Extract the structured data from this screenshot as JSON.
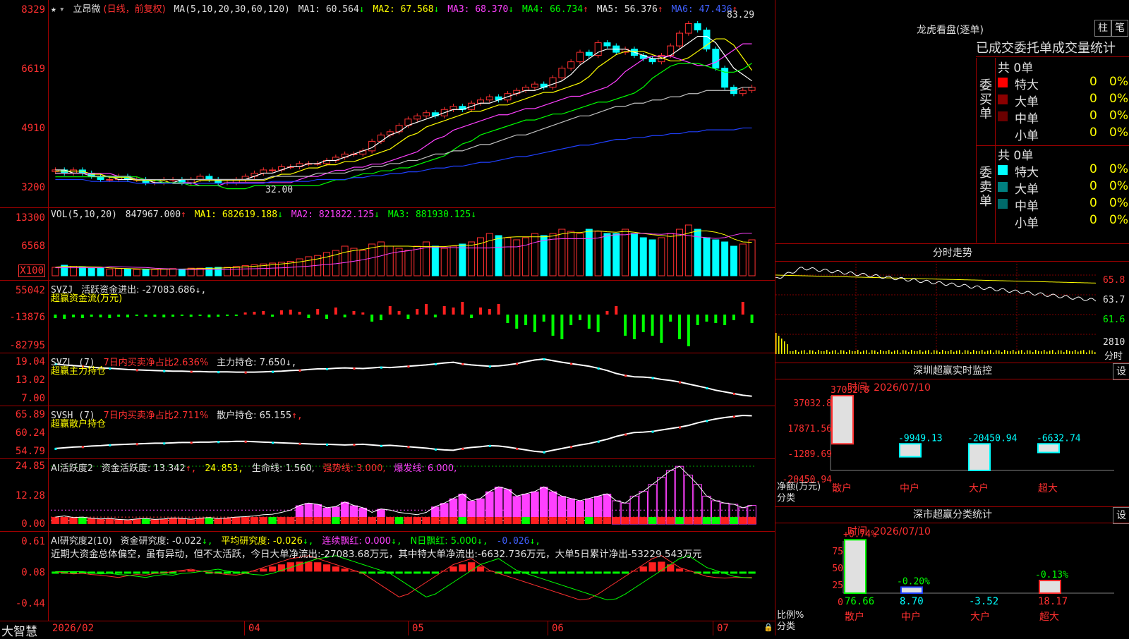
{
  "stock": {
    "name": "立昂微",
    "period": "(日线，前复权)"
  },
  "main": {
    "ma_label": "MA(5,10,20,30,60,120)",
    "ma1": "MA1: 60.564",
    "ma1_arrow": "↓",
    "ma2": "MA2: 67.568",
    "ma2_arrow": "↓",
    "ma3": "MA3: 68.370",
    "ma3_arrow": "↓",
    "ma4": "MA4: 66.734",
    "ma4_arrow": "↑",
    "ma5": "MA5: 56.376",
    "ma5_arrow": "↑",
    "ma6": "MA6: 47.436",
    "ma6_arrow": "↑",
    "y_ticks": [
      "8329",
      "6619",
      "4910",
      "3200"
    ],
    "high_label": "83.29",
    "low_label": "32.00"
  },
  "vol": {
    "label": "VOL(5,10,20)",
    "value": "847967.000",
    "value_arrow": "↑",
    "ma1": "MA1: 682619.188",
    "ma1_arrow": "↓",
    "ma2": "MA2: 821822.125",
    "ma2_arrow": "↓",
    "ma3": "MA3: 881930.125",
    "ma3_arrow": "↓",
    "y_ticks": [
      "13300",
      "6568"
    ],
    "unit": "X100"
  },
  "svzj": {
    "label": "SVZJ",
    "text": "活跃资金进出: -27083.686",
    "arrow": "↓,",
    "sub": "超赢资金流(万元)",
    "y_ticks": [
      "55042",
      "-13876",
      "-82795"
    ]
  },
  "svzl": {
    "label": "SVZL (7)",
    "ratio": "7日内买卖净占比2.636%",
    "hold": "主力持仓: 7.650",
    "arrow": "↓,",
    "sub": "超赢主力持仓",
    "y_ticks": [
      "19.04",
      "13.02",
      "7.00"
    ]
  },
  "svsh": {
    "label": "SVSH (7)",
    "ratio": "7日内买卖净占比2.711%",
    "hold": "散户持仓: 65.155",
    "arrow": "↑,",
    "sub": "超赢散户持仓",
    "y_ticks": [
      "65.89",
      "60.24",
      "54.79"
    ]
  },
  "ai1": {
    "label": "AI活跃度2",
    "t1": "资金活跃度: 13.342",
    "a1": "↑,",
    "t2": "24.853,",
    "t3": "生命线: 1.560,",
    "t4": "强势线: 3.000,",
    "t5": "爆发线: 6.000,",
    "y_ticks": [
      "24.85",
      "12.28",
      "0.00"
    ]
  },
  "ai2": {
    "label": "AI研究度2(10)",
    "t1": "资金研究度: -0.022",
    "a1": "↓,",
    "t2": "平均研究度: -0.026",
    "a2": "↓,",
    "t3": "连续飘红: 0.000",
    "a3": "↓,",
    "t4": "N日飘红: 5.000",
    "a4": "↓,",
    "t5": "-0.026",
    "a5": "↓,",
    "comment": "近期大资金总体偏空，虽有异动，但不太活跃，今日大单净流出:-27083.68万元，其中特大单净流出:-6632.736万元，大单5日累计净出-53229.543万元",
    "y_ticks": [
      "0.61",
      "0.08",
      "-0.44"
    ]
  },
  "x_axis": {
    "labels": [
      "2026/02",
      "04",
      "05",
      "06",
      "07"
    ],
    "brand": "大智慧"
  },
  "lhb": {
    "title": "龙虎看盘(逐单)",
    "btn1": "柱",
    "btn2": "笔",
    "header": "已成交委托单成交量统计",
    "buy_label": "委买单",
    "sell_label": "委卖单",
    "buy_total": "共 0单",
    "sell_total": "共 0单",
    "rows": [
      {
        "name": "特大",
        "v": "0",
        "p": "0%",
        "color": "#ff0000"
      },
      {
        "name": "大单",
        "v": "0",
        "p": "0%",
        "color": "#8b0000"
      },
      {
        "name": "中单",
        "v": "0",
        "p": "0%",
        "color": "#6b0000"
      },
      {
        "name": "小单",
        "v": "0",
        "p": "0%",
        "color": ""
      }
    ],
    "sell_rows": [
      {
        "name": "特大",
        "v": "0",
        "p": "0%",
        "color": "#00ffff"
      },
      {
        "name": "大单",
        "v": "0",
        "p": "0%",
        "color": "#008080"
      },
      {
        "name": "中单",
        "v": "0",
        "p": "0%",
        "color": "#006b6b"
      },
      {
        "name": "小单",
        "v": "0",
        "p": "0%",
        "color": ""
      }
    ]
  },
  "fenshi": {
    "title": "分时走势",
    "p1": "65.8",
    "p2": "63.7",
    "p3": "61.6",
    "vol": "2810",
    "vlab": "分时"
  },
  "monitor": {
    "title": "深圳超赢实时监控",
    "btn": "设",
    "time": "时间: 2026/07/10",
    "ylab": [
      "37032.8",
      "17871.56",
      "-1289.69",
      "-20450.94"
    ],
    "unit1": "净额(万元)",
    "unit2": "分类",
    "bars": [
      {
        "cat": "散户",
        "value": 37032.8,
        "label": "37032.8"
      },
      {
        "cat": "中户",
        "value": -9949.13,
        "label": "-9949.13"
      },
      {
        "cat": "大户",
        "value": -20450.94,
        "label": "-20450.94"
      },
      {
        "cat": "超大",
        "value": -6632.74,
        "label": "-6632.74"
      }
    ]
  },
  "classify": {
    "title": "深市超赢分类统计",
    "btn": "设",
    "time": "时间: 2026/07/10",
    "ylab": [
      "75",
      "50",
      "25",
      "0"
    ],
    "unit1": "比例%",
    "unit2": "分类",
    "bars": [
      {
        "cat": "散户",
        "value": 76.66,
        "chg": "+0.74%"
      },
      {
        "cat": "中户",
        "value": 8.7,
        "chg": "-0.20%"
      },
      {
        "cat": "大户",
        "value": -3.52,
        "chg": ""
      },
      {
        "cat": "超大",
        "value": 18.17,
        "chg": "-0.13%"
      }
    ],
    "vals": [
      "76.66",
      "8.70",
      "-3.52",
      "18.17"
    ]
  },
  "chart_data": {
    "type": "candlestick",
    "ylim": [
      3200,
      8329
    ],
    "closes": [
      36,
      35,
      36,
      35,
      34,
      33,
      33,
      34,
      33,
      33,
      32,
      32,
      33,
      33,
      32,
      33,
      34,
      33,
      32,
      32,
      33,
      34,
      35,
      36,
      36,
      37,
      37,
      38,
      38,
      38,
      39,
      40,
      41,
      41,
      42,
      45,
      47,
      48,
      50,
      52,
      53,
      54,
      53,
      55,
      56,
      55,
      57,
      58,
      59,
      58,
      60,
      61,
      62,
      63,
      62,
      65,
      68,
      70,
      73,
      72,
      76,
      75,
      73,
      74,
      72,
      71,
      70,
      72,
      75,
      79,
      82,
      80,
      74,
      68,
      62,
      60,
      61,
      62
    ],
    "ma5": [
      36,
      36,
      35,
      35,
      34,
      34,
      34,
      33,
      33,
      33,
      33,
      32,
      32,
      32,
      33,
      33,
      33,
      33,
      33,
      33,
      33,
      33,
      34,
      35,
      35,
      36,
      37,
      37,
      38,
      38,
      39,
      39,
      40,
      41,
      42,
      43,
      45,
      47,
      48,
      50,
      51,
      52,
      53,
      54,
      55,
      55,
      56,
      57,
      57,
      58,
      59,
      60,
      61,
      61,
      62,
      63,
      64,
      66,
      69,
      71,
      73,
      74,
      74,
      74,
      73,
      72,
      71,
      71,
      72,
      74,
      76,
      78,
      78,
      76,
      72,
      68,
      66,
      64
    ],
    "ma60": [
      35,
      35,
      35,
      35,
      34,
      34,
      34,
      34,
      34,
      33,
      33,
      33,
      33,
      33,
      33,
      33,
      33,
      33,
      33,
      33,
      33,
      33,
      33,
      33,
      34,
      34,
      34,
      34,
      34,
      35,
      35,
      35,
      35,
      36,
      36,
      37,
      37,
      38,
      38,
      39,
      39,
      40,
      41,
      41,
      42,
      42,
      43,
      44,
      44,
      45,
      46,
      47,
      47,
      48,
      49,
      50,
      51,
      52,
      53,
      53,
      54,
      55,
      56,
      56,
      57,
      57,
      58,
      58,
      59,
      59,
      60,
      60,
      61,
      61,
      61,
      61,
      62,
      62
    ],
    "vol": [
      2,
      2.5,
      2.2,
      2,
      1.8,
      1.8,
      1.6,
      1.7,
      1.6,
      1.5,
      1.5,
      1.5,
      1.6,
      1.7,
      1.6,
      1.8,
      1.8,
      1.9,
      2,
      2,
      2.2,
      2.4,
      2.6,
      2.8,
      3,
      3.2,
      3.4,
      4,
      4.5,
      4.8,
      5.5,
      6,
      7,
      6.5,
      6,
      7.5,
      8,
      7,
      6.5,
      6,
      7,
      8,
      7,
      6.5,
      7,
      7.5,
      8,
      9,
      10,
      9.5,
      9,
      8.5,
      9,
      10,
      9.5,
      10,
      11,
      10.5,
      10,
      11,
      10.5,
      10,
      10,
      11,
      10,
      9,
      8.5,
      9,
      10,
      11,
      12,
      11,
      9,
      8.5,
      8,
      7,
      7.5,
      8.5
    ],
    "svzj": [
      -5,
      -6,
      -4,
      -5,
      -3,
      -4,
      -5,
      -3,
      -4,
      -2,
      -3,
      -3,
      -4,
      -3,
      -2,
      -3,
      -2,
      -4,
      -3,
      -2,
      -2,
      3,
      4,
      5,
      -3,
      6,
      7,
      4,
      -5,
      8,
      -6,
      10,
      -4,
      5,
      3,
      -10,
      -8,
      12,
      5,
      -6,
      8,
      15,
      -4,
      12,
      10,
      18,
      -5,
      10,
      8,
      15,
      -12,
      -20,
      -15,
      -25,
      -10,
      -30,
      -35,
      -15,
      -8,
      -20,
      -25,
      5,
      12,
      -30,
      -35,
      -25,
      -30,
      -40,
      -10,
      -35,
      -45,
      -15,
      -10,
      -12,
      -15,
      -8,
      18,
      -12
    ],
    "svzl": [
      17.5,
      17.2,
      17,
      16.8,
      16.5,
      16.3,
      16.2,
      16,
      15.8,
      15.7,
      15.6,
      15.5,
      15.4,
      15.3,
      15.3,
      15.2,
      15.2,
      15.1,
      15.1,
      15.1,
      15,
      15,
      15,
      15.1,
      15.2,
      15.3,
      15.5,
      15.6,
      15.8,
      16,
      16,
      16.2,
      16.3,
      16.2,
      16.1,
      16.3,
      16.5,
      16.4,
      16.6,
      16.8,
      17,
      17.2,
      17.5,
      17.8,
      18,
      17.5,
      17.2,
      17,
      16.8,
      16.9,
      17.2,
      17.6,
      18.2,
      18.7,
      19,
      18.5,
      18,
      17.6,
      17.2,
      16.8,
      16.2,
      15.5,
      14.6,
      14,
      13.6,
      13.5,
      13.3,
      12.8,
      12.5,
      12,
      11.4,
      10.8,
      10.2,
      9.5,
      9,
      8.5,
      8,
      7.7
    ],
    "svsh": [
      56,
      56.2,
      56.4,
      56.5,
      56.7,
      56.8,
      57,
      57.1,
      57.2,
      57.3,
      57.4,
      57.5,
      57.5,
      57.6,
      57.7,
      57.7,
      57.8,
      57.8,
      57.9,
      57.9,
      58,
      58,
      57.9,
      57.8,
      57.7,
      57.6,
      57.5,
      57.4,
      57.3,
      57.2,
      57.2,
      57.1,
      57,
      57.1,
      57.2,
      57,
      56.8,
      56.9,
      56.7,
      56.5,
      56.3,
      56.1,
      55.8,
      55.6,
      55.5,
      56,
      56.3,
      56.5,
      56.8,
      56.7,
      56.4,
      56,
      55.6,
      55.2,
      55,
      55.5,
      56,
      56.5,
      57,
      57.4,
      58,
      58.6,
      59.4,
      60,
      60.5,
      60.6,
      60.8,
      61.2,
      61.6,
      62,
      62.5,
      63.2,
      63.8,
      64.3,
      64.7,
      65,
      65.3,
      65.2
    ],
    "ai1": [
      3,
      3.5,
      2.8,
      3,
      2.5,
      2.2,
      2.4,
      2,
      1.8,
      2.2,
      2.4,
      2,
      2.2,
      2.6,
      2.4,
      2.1,
      2.5,
      2.8,
      2.3,
      2.6,
      3,
      3.2,
      3.5,
      4,
      4.2,
      5,
      6,
      8,
      9,
      8.5,
      7,
      7.5,
      9.5,
      8,
      7,
      5,
      6.5,
      6,
      5,
      4.5,
      4,
      5,
      7.5,
      9,
      11,
      13,
      10,
      11,
      14,
      16,
      15,
      12,
      13,
      14,
      16,
      14,
      12,
      11,
      10,
      11,
      12,
      13,
      10,
      9,
      12,
      14,
      17,
      20,
      23,
      24.8,
      21,
      17,
      12,
      10,
      9,
      8.5,
      7,
      8
    ],
    "ai2": [
      0.08,
      0.06,
      0.04,
      0.05,
      0.03,
      0.02,
      0.0,
      -0.02,
      0.01,
      0.03,
      0.02,
      0.05,
      0.06,
      0.08,
      0.1,
      0.12,
      0.09,
      0.07,
      0.05,
      0.03,
      0.02,
      0.05,
      0.1,
      0.15,
      0.2,
      0.25,
      0.3,
      0.32,
      0.35,
      0.3,
      0.25,
      0.2,
      0.15,
      0.1,
      0.05,
      -0.05,
      -0.15,
      -0.25,
      -0.35,
      -0.3,
      -0.2,
      -0.1,
      0.0,
      0.1,
      0.2,
      0.25,
      0.3,
      0.2,
      0.1,
      0.05,
      0.0,
      -0.05,
      -0.1,
      -0.15,
      -0.2,
      -0.25,
      -0.3,
      -0.35,
      -0.4,
      -0.38,
      -0.3,
      -0.2,
      -0.1,
      0.0,
      0.1,
      0.2,
      0.3,
      0.35,
      0.25,
      0.15,
      0.1,
      0.05,
      0.0,
      -0.02,
      -0.03,
      -0.02,
      -0.02,
      -0.02
    ]
  }
}
